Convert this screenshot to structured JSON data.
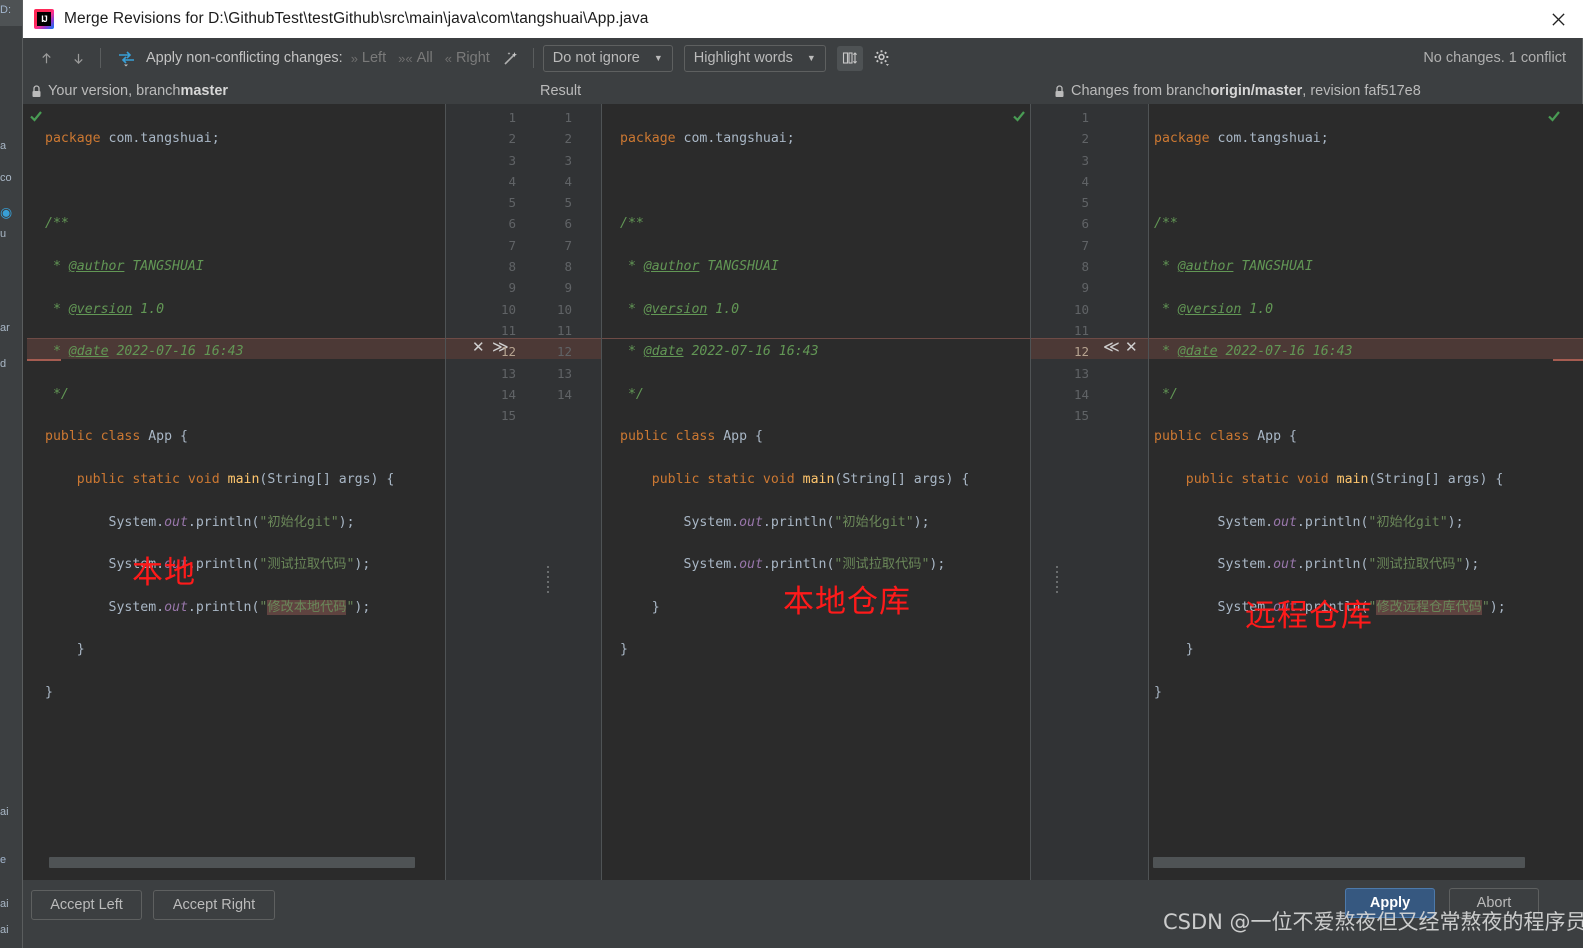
{
  "window": {
    "title": "Merge Revisions for D:\\GithubTest\\testGithub\\src\\main\\java\\com\\tangshuai\\App.java",
    "app_icon": "intellij-idea-icon",
    "close_label": "×"
  },
  "toolbar": {
    "prev_label": "↑",
    "next_label": "↓",
    "magic_label": "Apply non-conflicting changes:",
    "apply_left": "Left",
    "apply_all": "All",
    "apply_right": "Right",
    "ignore_combo": "Do not ignore",
    "highlight_combo": "Highlight words",
    "status": "No changes. 1 conflict"
  },
  "panes": {
    "left_header_prefix": "Your version, branch ",
    "left_header_bold": "master",
    "center_header": "Result",
    "right_header_prefix": "Changes from branch ",
    "right_header_bold": "origin/master",
    "right_header_suffix": ", revision faf517e8"
  },
  "annotations": {
    "left": "本地",
    "center": "本地仓库",
    "right": "远程仓库"
  },
  "conflict": {
    "left_markers": [
      "✕",
      "≫"
    ],
    "right_markers": [
      "≪",
      "✕"
    ],
    "line_number": "12"
  },
  "line_numbers": {
    "center_left": [
      "1",
      "2",
      "3",
      "4",
      "5",
      "6",
      "7",
      "8",
      "9",
      "10",
      "11",
      "12",
      "13",
      "14",
      "15"
    ],
    "center_right": [
      "1",
      "2",
      "3",
      "4",
      "5",
      "6",
      "7",
      "8",
      "9",
      "10",
      "11",
      "12",
      "13",
      "14",
      ""
    ],
    "right": [
      "1",
      "2",
      "3",
      "4",
      "5",
      "6",
      "7",
      "8",
      "9",
      "10",
      "11",
      "12",
      "13",
      "14",
      "15"
    ]
  },
  "code": {
    "left": [
      "package com.tangshuai;",
      "",
      "/**",
      " * @author TANGSHUAI",
      " * @version 1.0",
      " * @date 2022-07-16 16:43",
      " */",
      "public class App {",
      "    public static void main(String[] args) {",
      "        System.out.println(\"初始化git\");",
      "        System.out.println(\"测试拉取代码\");",
      "        System.out.println(\"修改本地代码\");",
      "    }",
      "}"
    ],
    "center": [
      "package com.tangshuai;",
      "",
      "/**",
      " * @author TANGSHUAI",
      " * @version 1.0",
      " * @date 2022-07-16 16:43",
      " */",
      "public class App {",
      "    public static void main(String[] args) {",
      "        System.out.println(\"初始化git\");",
      "        System.out.println(\"测试拉取代码\");",
      "    }",
      "}"
    ],
    "right": [
      "package com.tangshuai;",
      "",
      "/**",
      " * @author TANGSHUAI",
      " * @version 1.0",
      " * @date 2022-07-16 16:43",
      " */",
      "public class App {",
      "    public static void main(String[] args) {",
      "        System.out.println(\"初始化git\");",
      "        System.out.println(\"测试拉取代码\");",
      "        System.out.println(\"修改远程仓库代码\");",
      "    }",
      "}"
    ]
  },
  "buttons": {
    "accept_left": "Accept Left",
    "accept_right": "Accept Right",
    "apply": "Apply",
    "abort": "Abort"
  },
  "watermark": "CSDN @一位不爱熬夜但又经常熬夜的程序员",
  "colors": {
    "accent": "#365880",
    "conflict": "#4c3936",
    "note_red": "#ff1a1a",
    "editor_bg": "#2b2b2b",
    "chrome_bg": "#3c3f41"
  }
}
